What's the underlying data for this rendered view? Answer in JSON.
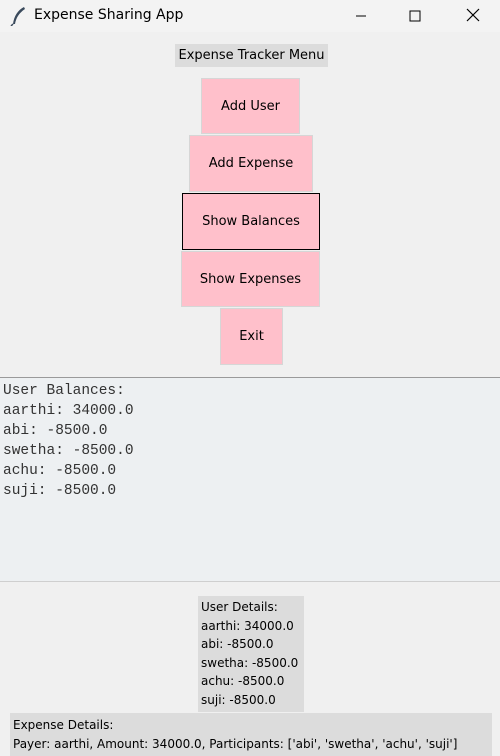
{
  "window": {
    "title": "Expense Sharing App"
  },
  "menu": {
    "label": "Expense Tracker Menu",
    "buttons": [
      {
        "label": "Add User"
      },
      {
        "label": "Add Expense"
      },
      {
        "label": "Show Balances"
      },
      {
        "label": "Show Expenses"
      },
      {
        "label": "Exit"
      }
    ],
    "button_color": "#ffc0cb"
  },
  "balances_text": {
    "lines": [
      "User Balances:",
      "aarthi: 34000.0",
      "abi: -8500.0",
      "swetha: -8500.0",
      "achu: -8500.0",
      "suji: -8500.0"
    ]
  },
  "user_details": {
    "lines": [
      "User Details:",
      "aarthi: 34000.0",
      "abi: -8500.0",
      "swetha: -8500.0",
      "achu: -8500.0",
      "suji: -8500.0"
    ]
  },
  "expense_details": {
    "lines": [
      "Expense Details:",
      "Payer: aarthi, Amount: 34000.0, Participants: ['abi', 'swetha', 'achu', 'suji']"
    ]
  },
  "icons": {
    "app": "feather-icon",
    "minimize": "minimize-icon",
    "maximize": "maximize-icon",
    "close": "close-icon"
  }
}
